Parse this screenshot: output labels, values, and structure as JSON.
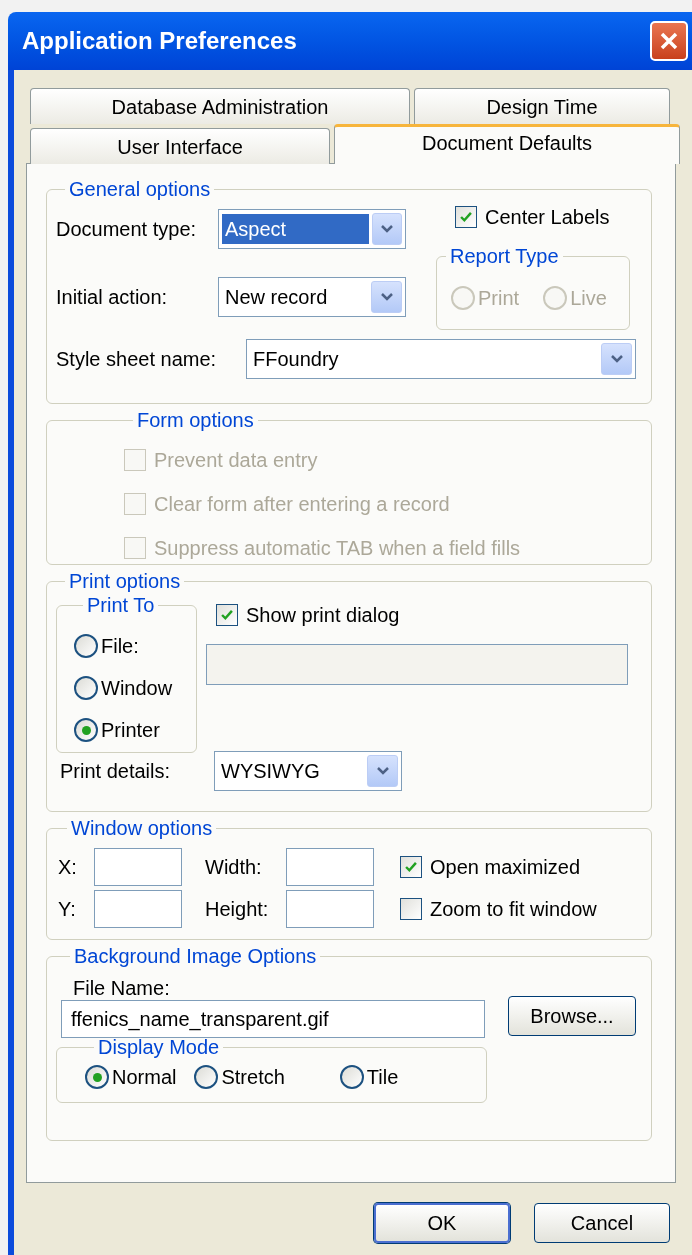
{
  "window": {
    "title": "Application Preferences"
  },
  "tab_rows": [
    [
      {
        "label": "Database Administration",
        "selected": false
      },
      {
        "label": "Design Time",
        "selected": false
      }
    ],
    [
      {
        "label": "User Interface",
        "selected": false
      },
      {
        "label": "Document Defaults",
        "selected": true
      }
    ]
  ],
  "general_options": {
    "title": "General options",
    "document_type": {
      "label": "Document type:",
      "value": "Aspect",
      "focused": true
    },
    "initial_action": {
      "label": "Initial action:",
      "value": "New record",
      "focused": false
    },
    "center_labels": {
      "label": "Center Labels",
      "checked": true
    },
    "report_type": {
      "title": "Report Type",
      "disabled": true,
      "options": [
        {
          "label": "Print",
          "selected": false
        },
        {
          "label": "Live",
          "selected": false
        }
      ]
    },
    "style_sheet": {
      "label": "Style sheet name:",
      "value": "FFoundry",
      "focused": false
    }
  },
  "form_options": {
    "title": "Form options",
    "disabled": true,
    "options": [
      {
        "label": "Prevent data entry",
        "checked": false
      },
      {
        "label": "Clear form after entering a record",
        "checked": false
      },
      {
        "label": "Suppress automatic TAB when a field fills",
        "checked": false
      }
    ]
  },
  "print_options": {
    "title": "Print options",
    "print_to": {
      "title": "Print To",
      "options": [
        {
          "label": "File:",
          "selected": false
        },
        {
          "label": "Window",
          "selected": false
        },
        {
          "label": "Printer",
          "selected": true
        }
      ]
    },
    "show_print_dialog": {
      "label": "Show print dialog",
      "checked": true
    },
    "file_field": {
      "disabled": true
    },
    "print_details": {
      "label": "Print details:",
      "value": "WYSIWYG",
      "focused": false
    }
  },
  "window_options": {
    "title": "Window options",
    "x_label": "X:",
    "y_label": "Y:",
    "width_label": "Width:",
    "height_label": "Height:",
    "open_maximized": {
      "label": "Open maximized",
      "checked": true
    },
    "zoom_to_fit": {
      "label": "Zoom to fit window",
      "checked": false
    }
  },
  "background_image": {
    "title": "Background Image Options",
    "file_name_label": "File Name:",
    "file_name": "ffenics_name_transparent.gif",
    "browse": "Browse...",
    "display_mode": {
      "title": "Display Mode",
      "options": [
        {
          "label": "Normal",
          "selected": true
        },
        {
          "label": "Stretch",
          "selected": false
        },
        {
          "label": "Tile",
          "selected": false
        }
      ]
    }
  },
  "buttons": [
    {
      "label": "OK",
      "default": true
    },
    {
      "label": "Cancel",
      "default": false
    }
  ]
}
